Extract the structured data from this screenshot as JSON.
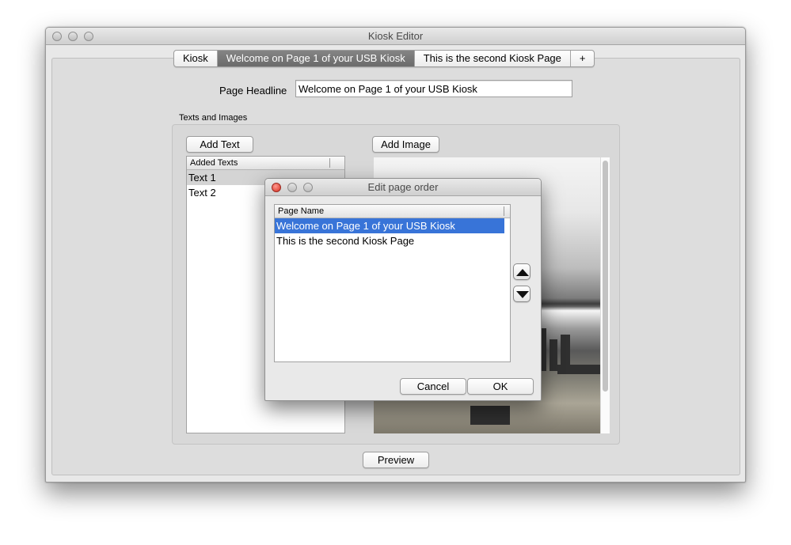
{
  "window": {
    "title": "Kiosk Editor"
  },
  "tabs": [
    {
      "label": "Kiosk",
      "selected": false
    },
    {
      "label": "Welcome on Page 1 of your USB Kiosk",
      "selected": true
    },
    {
      "label": "This is the second Kiosk Page",
      "selected": false
    },
    {
      "label": "+",
      "selected": false
    }
  ],
  "headline": {
    "label": "Page Headline",
    "value": "Welcome on Page 1 of your USB Kiosk"
  },
  "group": {
    "title": "Texts and Images",
    "add_text_label": "Add Text",
    "add_image_label": "Add Image",
    "texts_header": "Added Texts",
    "texts": [
      "Text 1",
      "Text 2"
    ]
  },
  "preview_label": "Preview",
  "dialog": {
    "title": "Edit page order",
    "column_header": "Page Name",
    "pages": [
      "Welcome on Page 1 of your USB Kiosk",
      "This is the second Kiosk Page"
    ],
    "cancel_label": "Cancel",
    "ok_label": "OK"
  },
  "colors": {
    "selection": "#3874d8",
    "selected_tab": "#747474"
  }
}
